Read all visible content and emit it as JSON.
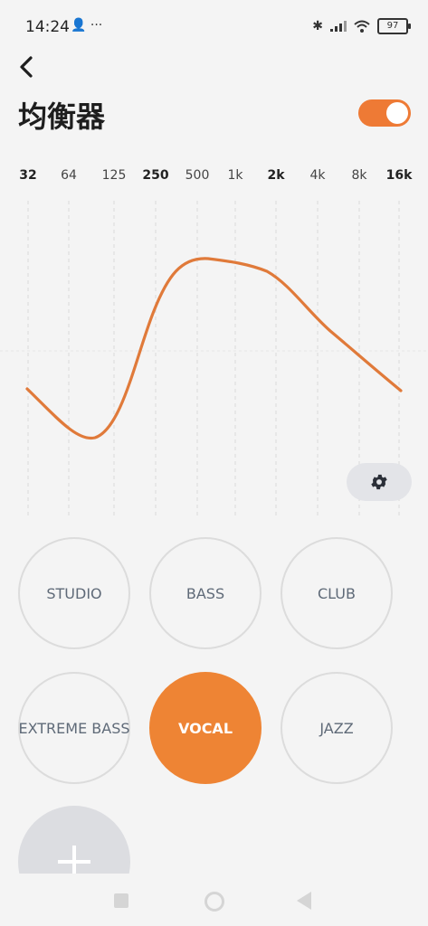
{
  "status_bar": {
    "time": "14:24",
    "notification_icons": "person-icon more-icon",
    "battery": "97"
  },
  "header": {
    "title": "均衡器",
    "enabled": true
  },
  "frequencies": [
    "32",
    "64",
    "125",
    "250",
    "500",
    "1k",
    "2k",
    "4k",
    "8k",
    "16k"
  ],
  "presets": [
    {
      "label": "STUDIO",
      "active": false
    },
    {
      "label": "BASS",
      "active": false
    },
    {
      "label": "CLUB",
      "active": false
    },
    {
      "label": "EXTREME BASS",
      "active": false
    },
    {
      "label": "VOCAL",
      "active": true
    },
    {
      "label": "JAZZ",
      "active": false
    }
  ],
  "colors": {
    "accent": "#ee8434",
    "curve": "#e07a3a",
    "toggle": "#ee7a35"
  },
  "icons": {
    "back": "chevron-left-icon",
    "settings": "gear-icon",
    "add": "plus-icon"
  }
}
